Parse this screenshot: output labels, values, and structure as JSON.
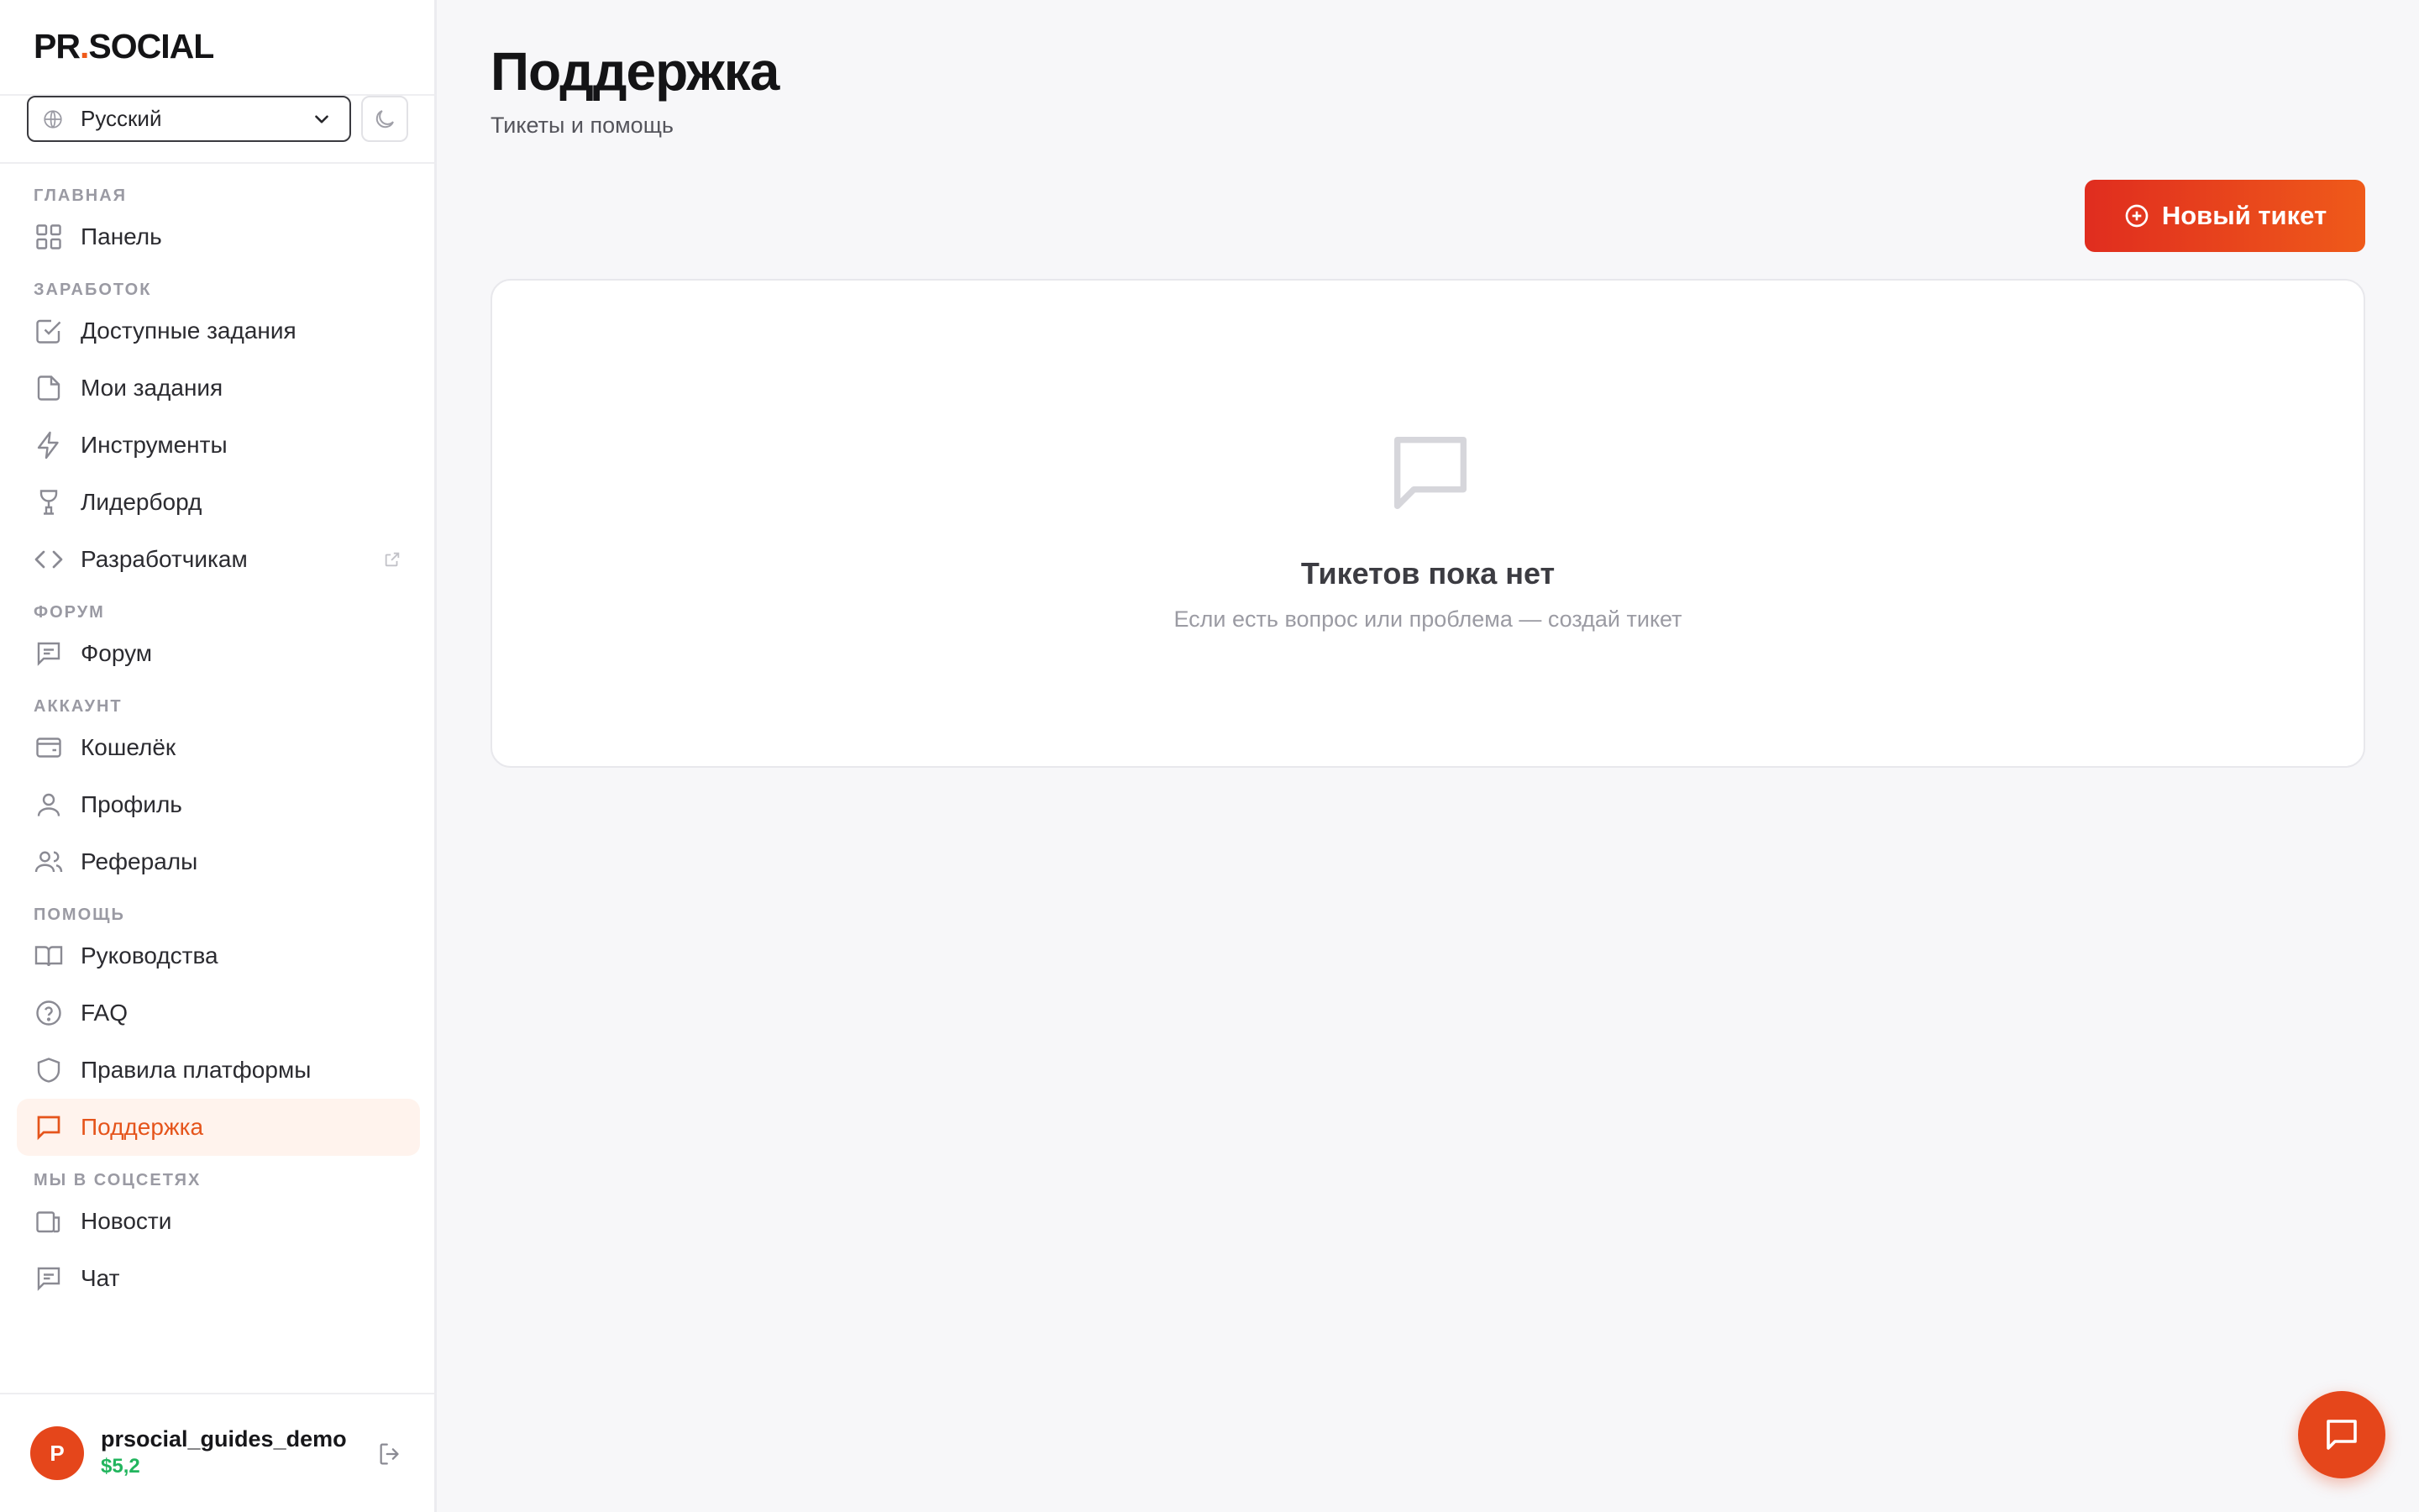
{
  "brand": {
    "logo_prefix": "PR",
    "logo_dot": ".",
    "logo_suffix": "SOCIAL",
    "accent": "#e5541b"
  },
  "language": {
    "selected": "Русский"
  },
  "sidebar": {
    "sections": [
      {
        "label": "ГЛАВНАЯ",
        "items": [
          {
            "label": "Панель",
            "icon": "grid-icon"
          }
        ]
      },
      {
        "label": "ЗАРАБОТОК",
        "items": [
          {
            "label": "Доступные задания",
            "icon": "check-square-icon"
          },
          {
            "label": "Мои задания",
            "icon": "file-icon"
          },
          {
            "label": "Инструменты",
            "icon": "lightning-icon"
          },
          {
            "label": "Лидерборд",
            "icon": "trophy-icon"
          },
          {
            "label": "Разработчикам",
            "icon": "code-icon",
            "external": true
          }
        ]
      },
      {
        "label": "ФОРУМ",
        "items": [
          {
            "label": "Форум",
            "icon": "forum-icon"
          }
        ]
      },
      {
        "label": "АККАУНТ",
        "items": [
          {
            "label": "Кошелёк",
            "icon": "wallet-icon"
          },
          {
            "label": "Профиль",
            "icon": "user-icon"
          },
          {
            "label": "Рефералы",
            "icon": "users-icon"
          }
        ]
      },
      {
        "label": "ПОМОЩЬ",
        "items": [
          {
            "label": "Руководства",
            "icon": "book-icon"
          },
          {
            "label": "FAQ",
            "icon": "help-circle-icon"
          },
          {
            "label": "Правила платформы",
            "icon": "shield-icon"
          },
          {
            "label": "Поддержка",
            "icon": "chat-icon",
            "active": true
          }
        ]
      },
      {
        "label": "МЫ В СОЦСЕТЯХ",
        "items": [
          {
            "label": "Новости",
            "icon": "news-icon"
          },
          {
            "label": "Чат",
            "icon": "chat-lines-icon"
          }
        ]
      }
    ]
  },
  "user": {
    "avatar_letter": "P",
    "name": "prsocial_guides_demo",
    "balance": "$5,2"
  },
  "main": {
    "title": "Поддержка",
    "subtitle": "Тикеты и помощь",
    "new_ticket_label": "Новый тикет",
    "empty_title": "Тикетов пока нет",
    "empty_subtitle": "Если есть вопрос или проблема — создай тикет"
  }
}
